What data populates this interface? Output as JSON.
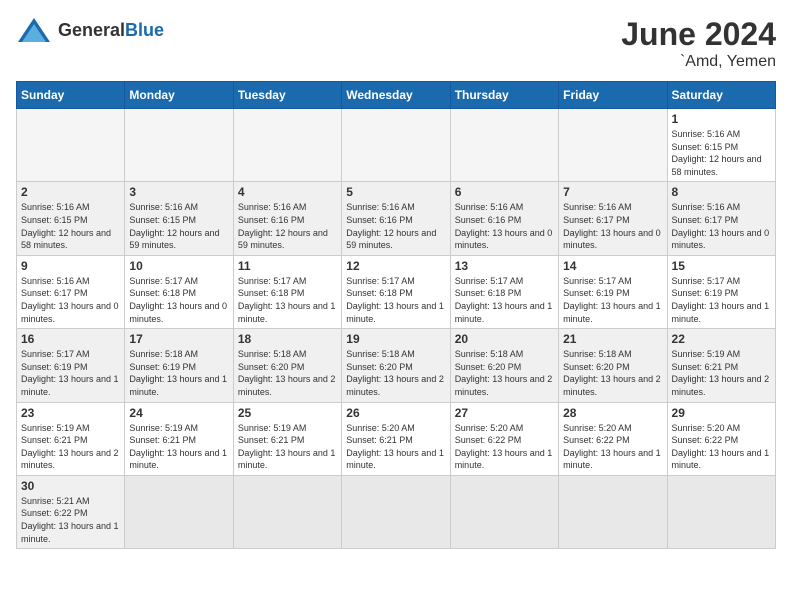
{
  "header": {
    "logo_general": "General",
    "logo_blue": "Blue",
    "month_year": "June 2024",
    "location": "`Amd, Yemen"
  },
  "days_of_week": [
    "Sunday",
    "Monday",
    "Tuesday",
    "Wednesday",
    "Thursday",
    "Friday",
    "Saturday"
  ],
  "weeks": [
    {
      "days": [
        {
          "num": "",
          "empty": true
        },
        {
          "num": "",
          "empty": true
        },
        {
          "num": "",
          "empty": true
        },
        {
          "num": "",
          "empty": true
        },
        {
          "num": "",
          "empty": true
        },
        {
          "num": "",
          "empty": true
        },
        {
          "num": "1",
          "info": "Sunrise: 5:16 AM\nSunset: 6:15 PM\nDaylight: 12 hours\nand 58 minutes."
        }
      ]
    },
    {
      "days": [
        {
          "num": "2",
          "info": "Sunrise: 5:16 AM\nSunset: 6:15 PM\nDaylight: 12 hours\nand 58 minutes."
        },
        {
          "num": "3",
          "info": "Sunrise: 5:16 AM\nSunset: 6:15 PM\nDaylight: 12 hours\nand 59 minutes."
        },
        {
          "num": "4",
          "info": "Sunrise: 5:16 AM\nSunset: 6:16 PM\nDaylight: 12 hours\nand 59 minutes."
        },
        {
          "num": "5",
          "info": "Sunrise: 5:16 AM\nSunset: 6:16 PM\nDaylight: 12 hours\nand 59 minutes."
        },
        {
          "num": "6",
          "info": "Sunrise: 5:16 AM\nSunset: 6:16 PM\nDaylight: 13 hours\nand 0 minutes."
        },
        {
          "num": "7",
          "info": "Sunrise: 5:16 AM\nSunset: 6:17 PM\nDaylight: 13 hours\nand 0 minutes."
        },
        {
          "num": "8",
          "info": "Sunrise: 5:16 AM\nSunset: 6:17 PM\nDaylight: 13 hours\nand 0 minutes."
        }
      ]
    },
    {
      "days": [
        {
          "num": "9",
          "info": "Sunrise: 5:16 AM\nSunset: 6:17 PM\nDaylight: 13 hours\nand 0 minutes."
        },
        {
          "num": "10",
          "info": "Sunrise: 5:17 AM\nSunset: 6:18 PM\nDaylight: 13 hours\nand 0 minutes."
        },
        {
          "num": "11",
          "info": "Sunrise: 5:17 AM\nSunset: 6:18 PM\nDaylight: 13 hours\nand 1 minute."
        },
        {
          "num": "12",
          "info": "Sunrise: 5:17 AM\nSunset: 6:18 PM\nDaylight: 13 hours\nand 1 minute."
        },
        {
          "num": "13",
          "info": "Sunrise: 5:17 AM\nSunset: 6:18 PM\nDaylight: 13 hours\nand 1 minute."
        },
        {
          "num": "14",
          "info": "Sunrise: 5:17 AM\nSunset: 6:19 PM\nDaylight: 13 hours\nand 1 minute."
        },
        {
          "num": "15",
          "info": "Sunrise: 5:17 AM\nSunset: 6:19 PM\nDaylight: 13 hours\nand 1 minute."
        }
      ]
    },
    {
      "days": [
        {
          "num": "16",
          "info": "Sunrise: 5:17 AM\nSunset: 6:19 PM\nDaylight: 13 hours\nand 1 minute."
        },
        {
          "num": "17",
          "info": "Sunrise: 5:18 AM\nSunset: 6:19 PM\nDaylight: 13 hours\nand 1 minute."
        },
        {
          "num": "18",
          "info": "Sunrise: 5:18 AM\nSunset: 6:20 PM\nDaylight: 13 hours\nand 2 minutes."
        },
        {
          "num": "19",
          "info": "Sunrise: 5:18 AM\nSunset: 6:20 PM\nDaylight: 13 hours\nand 2 minutes."
        },
        {
          "num": "20",
          "info": "Sunrise: 5:18 AM\nSunset: 6:20 PM\nDaylight: 13 hours\nand 2 minutes."
        },
        {
          "num": "21",
          "info": "Sunrise: 5:18 AM\nSunset: 6:20 PM\nDaylight: 13 hours\nand 2 minutes."
        },
        {
          "num": "22",
          "info": "Sunrise: 5:19 AM\nSunset: 6:21 PM\nDaylight: 13 hours\nand 2 minutes."
        }
      ]
    },
    {
      "days": [
        {
          "num": "23",
          "info": "Sunrise: 5:19 AM\nSunset: 6:21 PM\nDaylight: 13 hours\nand 2 minutes."
        },
        {
          "num": "24",
          "info": "Sunrise: 5:19 AM\nSunset: 6:21 PM\nDaylight: 13 hours\nand 1 minute."
        },
        {
          "num": "25",
          "info": "Sunrise: 5:19 AM\nSunset: 6:21 PM\nDaylight: 13 hours\nand 1 minute."
        },
        {
          "num": "26",
          "info": "Sunrise: 5:20 AM\nSunset: 6:21 PM\nDaylight: 13 hours\nand 1 minute."
        },
        {
          "num": "27",
          "info": "Sunrise: 5:20 AM\nSunset: 6:22 PM\nDaylight: 13 hours\nand 1 minute."
        },
        {
          "num": "28",
          "info": "Sunrise: 5:20 AM\nSunset: 6:22 PM\nDaylight: 13 hours\nand 1 minute."
        },
        {
          "num": "29",
          "info": "Sunrise: 5:20 AM\nSunset: 6:22 PM\nDaylight: 13 hours\nand 1 minute."
        }
      ]
    },
    {
      "days": [
        {
          "num": "30",
          "info": "Sunrise: 5:21 AM\nSunset: 6:22 PM\nDaylight: 13 hours\nand 1 minute."
        },
        {
          "num": "",
          "empty": true
        },
        {
          "num": "",
          "empty": true
        },
        {
          "num": "",
          "empty": true
        },
        {
          "num": "",
          "empty": true
        },
        {
          "num": "",
          "empty": true
        },
        {
          "num": "",
          "empty": true
        }
      ]
    }
  ]
}
